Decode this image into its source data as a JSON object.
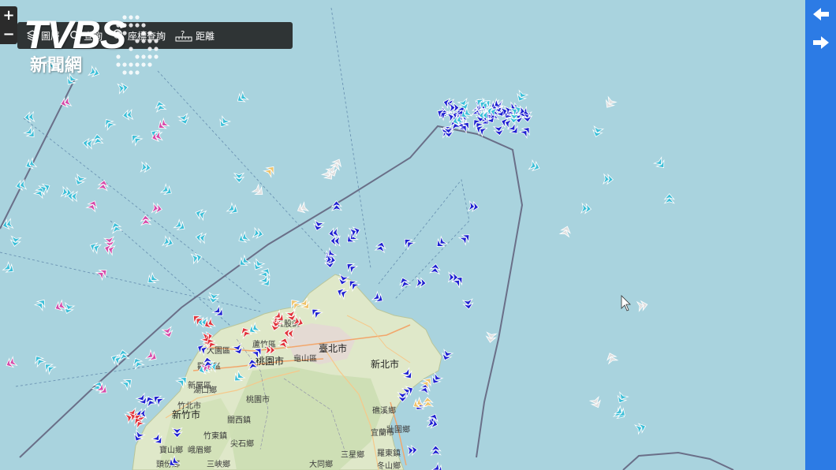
{
  "logo": {
    "brand": "TVBS",
    "sub": "新聞網"
  },
  "zoom": {
    "in": "+",
    "out": "−"
  },
  "toolbar": [
    {
      "label": "圖層",
      "icon": "layers-icon"
    },
    {
      "label": "查詢",
      "icon": "search-icon"
    },
    {
      "label": "座標查詢",
      "icon": "map-pin-icon"
    },
    {
      "label": "距離",
      "icon": "ruler-icon"
    }
  ],
  "nav": {
    "back": "back-arrow-icon",
    "forward": "forward-arrow-icon"
  },
  "places": [
    {
      "name": "臺北市",
      "big": true
    },
    {
      "name": "新北市",
      "big": true
    },
    {
      "name": "桃園市",
      "big": true
    },
    {
      "name": "桃園市",
      "big": false
    },
    {
      "name": "新竹市",
      "big": true
    },
    {
      "name": "蘆竹區",
      "big": false
    },
    {
      "name": "大園區",
      "big": false
    },
    {
      "name": "龜山區",
      "big": false
    },
    {
      "name": "觀音區",
      "big": false
    },
    {
      "name": "新屋區",
      "big": false
    },
    {
      "name": "湖口鄉",
      "big": false
    },
    {
      "name": "竹北市",
      "big": false
    },
    {
      "name": "關西鎮",
      "big": false
    },
    {
      "name": "竹東鎮",
      "big": false
    },
    {
      "name": "尖石鄉",
      "big": false
    },
    {
      "name": "峨眉鄉",
      "big": false
    },
    {
      "name": "三峽鄉",
      "big": false
    },
    {
      "name": "寶山鄉",
      "big": false
    },
    {
      "name": "頭份鄉",
      "big": false
    },
    {
      "name": "大同鄉",
      "big": false
    },
    {
      "name": "礁溪鄉",
      "big": false
    },
    {
      "name": "宜蘭市",
      "big": false
    },
    {
      "name": "羅東鎮",
      "big": false
    },
    {
      "name": "三星鄉",
      "big": false
    },
    {
      "name": "冬山鄉",
      "big": false
    },
    {
      "name": "五股區",
      "big": false
    },
    {
      "name": "壯圍鄉",
      "big": false
    }
  ],
  "colors": {
    "sea": "#a9d3de",
    "land": "#dfe8c9",
    "boundary": "#6a6f88",
    "cargo": "#1d1fd1",
    "tanker": "#e0323a",
    "passenger": "#d64aa9",
    "fishing": "#3bbfd8",
    "other": "#e0e0e0",
    "tug": "#efc36b",
    "accent": "#2c7be5"
  }
}
